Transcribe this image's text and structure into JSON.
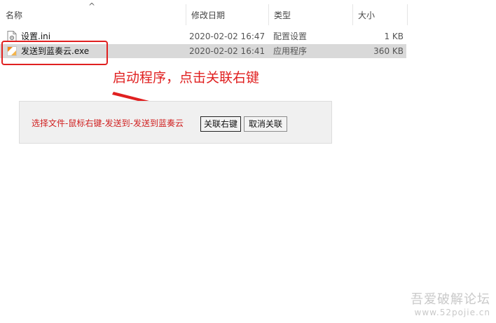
{
  "columns": {
    "name": "名称",
    "date": "修改日期",
    "type": "类型",
    "size": "大小"
  },
  "files": [
    {
      "name": "设置.ini",
      "date": "2020-02-02 16:47",
      "type": "配置设置",
      "size": "1 KB",
      "icon": "ini-file-icon",
      "selected": false
    },
    {
      "name": "发送到蓝奏云.exe",
      "date": "2020-02-02 16:41",
      "type": "应用程序",
      "size": "360 KB",
      "icon": "exe-file-icon",
      "selected": true
    }
  ],
  "annotation": {
    "text": "启动程序，点击关联右键"
  },
  "panel": {
    "label": "选择文件-鼠标右键-发送到-发送到蓝奏云",
    "associate_label": "关联右键",
    "unassociate_label": "取消关联"
  },
  "watermark": {
    "name": "吾爱破解论坛",
    "url": "www.52pojie.cn"
  },
  "colors": {
    "annotation": "#e02020",
    "selected_row": "#d9d9d9"
  }
}
